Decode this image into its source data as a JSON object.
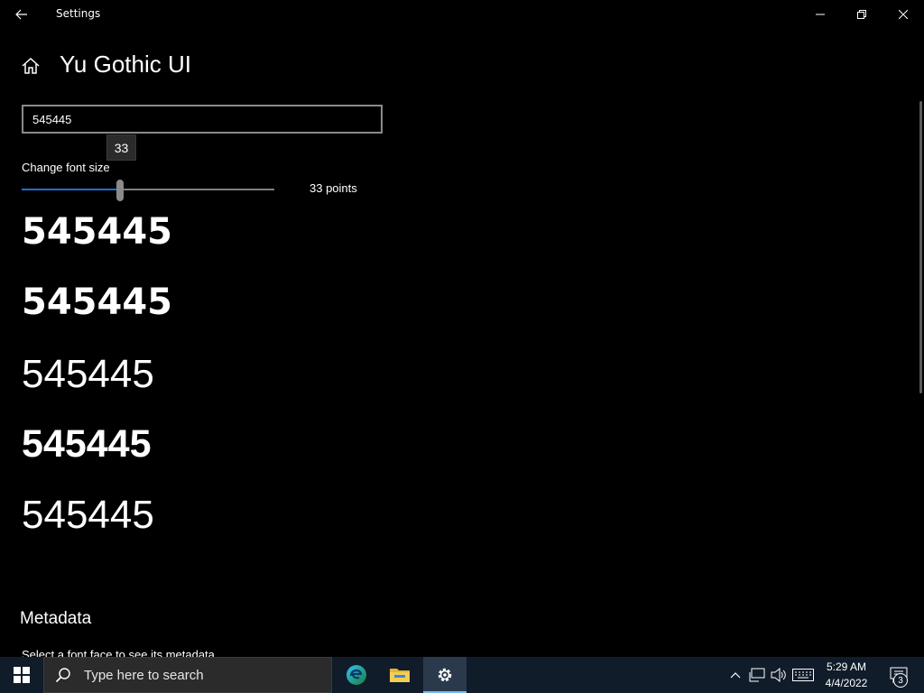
{
  "window": {
    "title": "Settings"
  },
  "header": {
    "title": "Yu Gothic UI"
  },
  "preview": {
    "input_value": "545445"
  },
  "font_size": {
    "label": "Change font size",
    "tooltip": "33",
    "value_text": "33 points",
    "slider_fraction": 0.39
  },
  "samples": [
    "545445",
    "545445",
    "545445",
    "545445",
    "545445"
  ],
  "metadata": {
    "title": "Metadata",
    "hint": "Select a font face to see its metadata"
  },
  "taskbar": {
    "search_placeholder": "Type here to search",
    "time": "5:29 AM",
    "date": "4/4/2022",
    "notification_count": "3"
  },
  "colors": {
    "background": "#000000",
    "accent": "#1e6fd9",
    "taskbar": "#101c2a"
  }
}
